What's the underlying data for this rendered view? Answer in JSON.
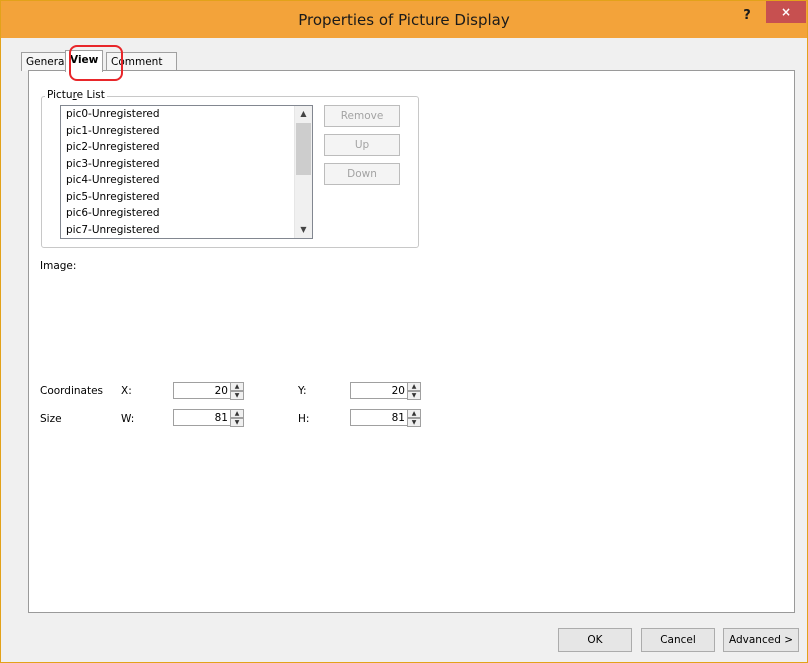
{
  "window": {
    "title": "Properties of Picture Display",
    "help": "?",
    "close": "×"
  },
  "tabs": [
    {
      "label": "General"
    },
    {
      "label": "View"
    },
    {
      "label": "Comment"
    }
  ],
  "picture_list": {
    "label": "Picture List",
    "items": [
      "pic0-Unregistered",
      "pic1-Unregistered",
      "pic2-Unregistered",
      "pic3-Unregistered",
      "pic4-Unregistered",
      "pic5-Unregistered",
      "pic6-Unregistered",
      "pic7-Unregistered"
    ],
    "buttons": {
      "remove": "Remove",
      "up": "Up",
      "down": "Down"
    }
  },
  "image_label": "Image:",
  "coordinates": {
    "label": "Coordinates",
    "x_label": "X:",
    "x_value": "20",
    "y_label": "Y:",
    "y_value": "20"
  },
  "size": {
    "label": "Size",
    "w_label": "W:",
    "w_value": "81",
    "h_label": "H:",
    "h_value": "81"
  },
  "footer": {
    "ok": "OK",
    "cancel": "Cancel",
    "advanced": "Advanced >"
  }
}
